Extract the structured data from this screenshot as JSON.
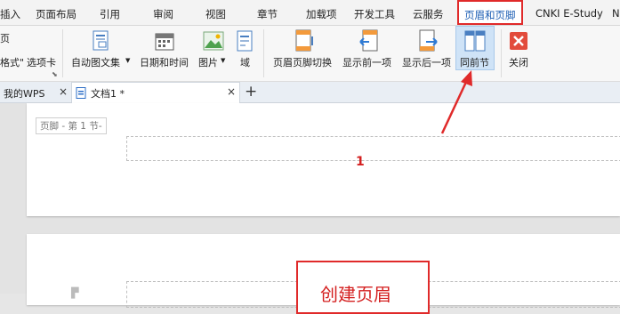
{
  "menu": {
    "tabs": [
      "插入",
      "页面布局",
      "引用",
      "审阅",
      "视图",
      "章节",
      "加载项",
      "开发工具",
      "云服务",
      "页眉和页脚",
      "CNKI E-Study",
      "N"
    ]
  },
  "ribbon": {
    "left_top": "页",
    "left_format": "格式\"",
    "tab_card": "选项卡",
    "auto_figure": "自动图文集",
    "date_time": "日期和时间",
    "picture": "图片",
    "field": "域",
    "switch": "页眉页脚切换",
    "prev": "显示前一项",
    "next": "显示后一项",
    "same_as_prev": "同前节",
    "close": "关闭"
  },
  "tabbar": {
    "my_wps": "我的WPS",
    "doc_name": "文档1 *",
    "close": "×",
    "add": "+"
  },
  "document": {
    "footer_label": "页脚 - 第 1 节-",
    "page_number": "1",
    "caption": "创建页眉"
  },
  "colors": {
    "accent": "#1e5fb4",
    "highlight_red": "#e02a2a",
    "selected_button_bg": "#cfe3f7"
  }
}
